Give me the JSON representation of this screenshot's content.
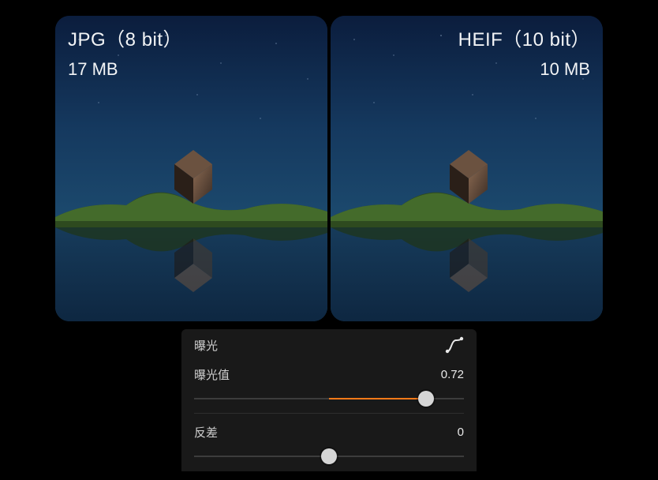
{
  "compare": {
    "left": {
      "format_label": "JPG（8 bit）",
      "size_label": "17 MB",
      "align": "left"
    },
    "right": {
      "format_label": "HEIF（10 bit）",
      "size_label": "10 MB",
      "align": "right"
    }
  },
  "edit_panel": {
    "section_label": "曝光",
    "curve_icon": "curve-icon",
    "controls": [
      {
        "label": "曝光值",
        "value_text": "0.72",
        "value": 0.72,
        "min": -1,
        "max": 1,
        "fill_from_center": true
      },
      {
        "label": "反差",
        "value_text": "0",
        "value": 0.0,
        "min": -1,
        "max": 1,
        "fill_from_center": true
      }
    ],
    "accent_color": "#ff7a18"
  }
}
